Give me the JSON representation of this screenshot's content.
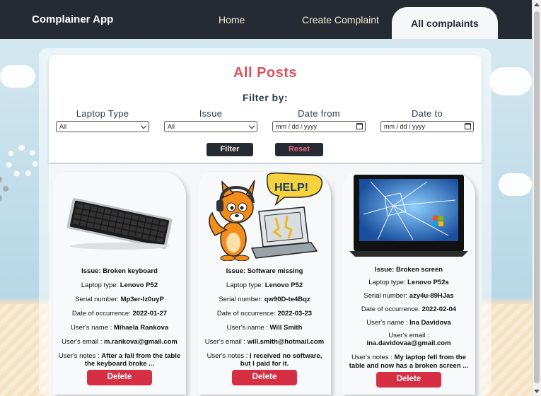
{
  "navbar": {
    "brand": "Complainer App",
    "links": {
      "home": "Home",
      "create": "Create Complaint",
      "all": "All complaints"
    }
  },
  "page": {
    "title": "All Posts",
    "filter_by": "Filter by:"
  },
  "filters": {
    "laptop_type": {
      "label": "Laptop Type",
      "value": "All"
    },
    "issue": {
      "label": "Issue",
      "value": "All"
    },
    "date_from": {
      "label": "Date from",
      "value": "mm / dd / yyyy"
    },
    "date_to": {
      "label": "Date to",
      "value": "mm / dd / yyyy"
    },
    "filter_button": "Filter",
    "reset_button": "Reset"
  },
  "labels": {
    "issue": "Issue: ",
    "laptop_type": "Laptop type: ",
    "serial": "Serial number: ",
    "date": "Date of occurrence: ",
    "name": "User's name : ",
    "email": "User's email : ",
    "notes": "User's notes : ",
    "delete": "Delete"
  },
  "posts": [
    {
      "issue": "Broken keyboard",
      "laptop": "Lenovo P52",
      "serial": "Mp3er-Iz0uyP",
      "date": "2022-01-27",
      "name": "Mihaela Rankova",
      "email": "m.rankova@gmail.com",
      "notes": "After a fall from the table the keyboard broke ...",
      "image": "keyboard-photo"
    },
    {
      "issue": "Software missing",
      "laptop": "Lenovo P52",
      "serial": "qw90D-te4Bqz",
      "date": "2022-03-23",
      "name": "Will Smith",
      "email": "will.smith@hotmail.com",
      "notes": "I received no software, but I paid for it.",
      "image": "help-fox-cartoon",
      "help_text": "HELP!"
    },
    {
      "issue": "Broken screen",
      "laptop": "Lenovo P52s",
      "serial": "azy4u-89HJas",
      "date": "2022-02-04",
      "name": "Ina Davidova",
      "email": "ina.davidovaa@gmail.com",
      "notes": "My laptop fell from the table and now has a broken screen ...",
      "image": "cracked-laptop-photo"
    }
  ],
  "colors": {
    "navbar": "#262a33",
    "title": "#e0505d",
    "delete": "#d62f44",
    "reset_text": "#e4677a"
  }
}
